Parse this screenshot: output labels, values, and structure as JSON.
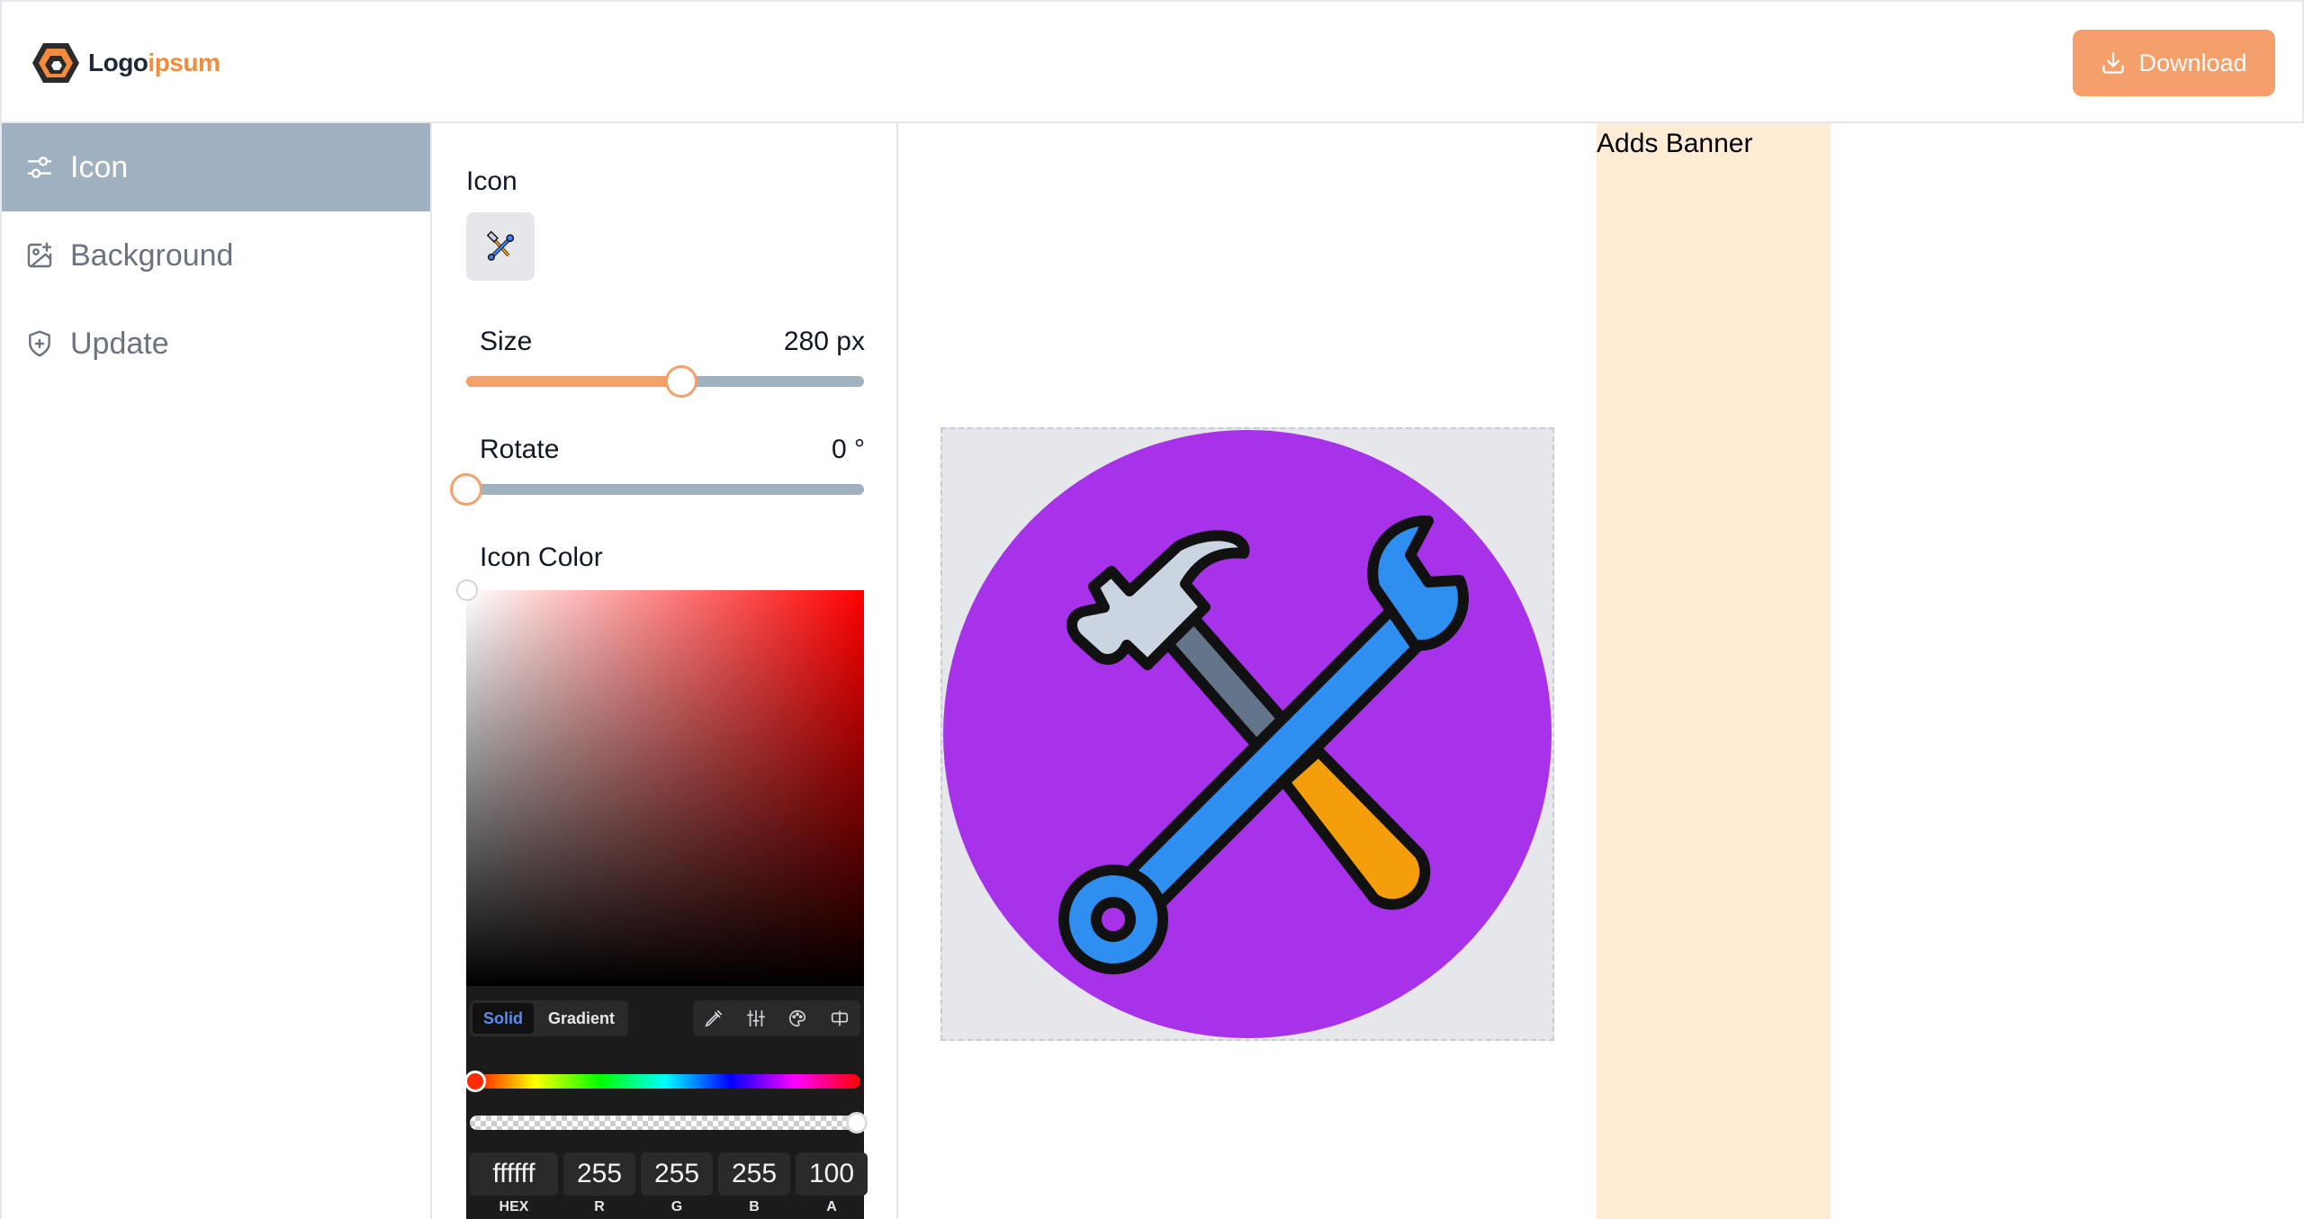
{
  "header": {
    "logo_part1": "Logo",
    "logo_part2": "ipsum",
    "download_label": "Download"
  },
  "sidebar": {
    "items": [
      {
        "label": "Icon",
        "icon": "sliders-icon",
        "active": true
      },
      {
        "label": "Background",
        "icon": "image-plus-icon",
        "active": false
      },
      {
        "label": "Update",
        "icon": "shield-plus-icon",
        "active": false
      }
    ]
  },
  "panel": {
    "icon_label": "Icon",
    "selected_icon": "hammer-wrench-icon",
    "size_label": "Size",
    "size_value": "280 px",
    "size_fraction": 0.54,
    "rotate_label": "Rotate",
    "rotate_value": "0 °",
    "rotate_fraction": 0.0,
    "icon_color_label": "Icon Color"
  },
  "color_picker": {
    "tabs": [
      "Solid",
      "Gradient"
    ],
    "active_tab": "Solid",
    "tools": [
      "eyedropper-icon",
      "sliders-vertical-icon",
      "palette-icon",
      "compare-icon"
    ],
    "hex": "ffffff",
    "r": "255",
    "g": "255",
    "b": "255",
    "a": "100",
    "labels": {
      "hex": "HEX",
      "r": "R",
      "g": "G",
      "b": "B",
      "a": "A"
    },
    "hue_color": "#ff0000"
  },
  "preview": {
    "background_color": "#a832ea",
    "canvas_color": "#e5e7eb",
    "icon": "hammer-wrench-icon"
  },
  "banner": {
    "text": "Adds Banner"
  },
  "colors": {
    "accent": "#f5a06b",
    "sidebar_active": "#9fb0c0"
  }
}
